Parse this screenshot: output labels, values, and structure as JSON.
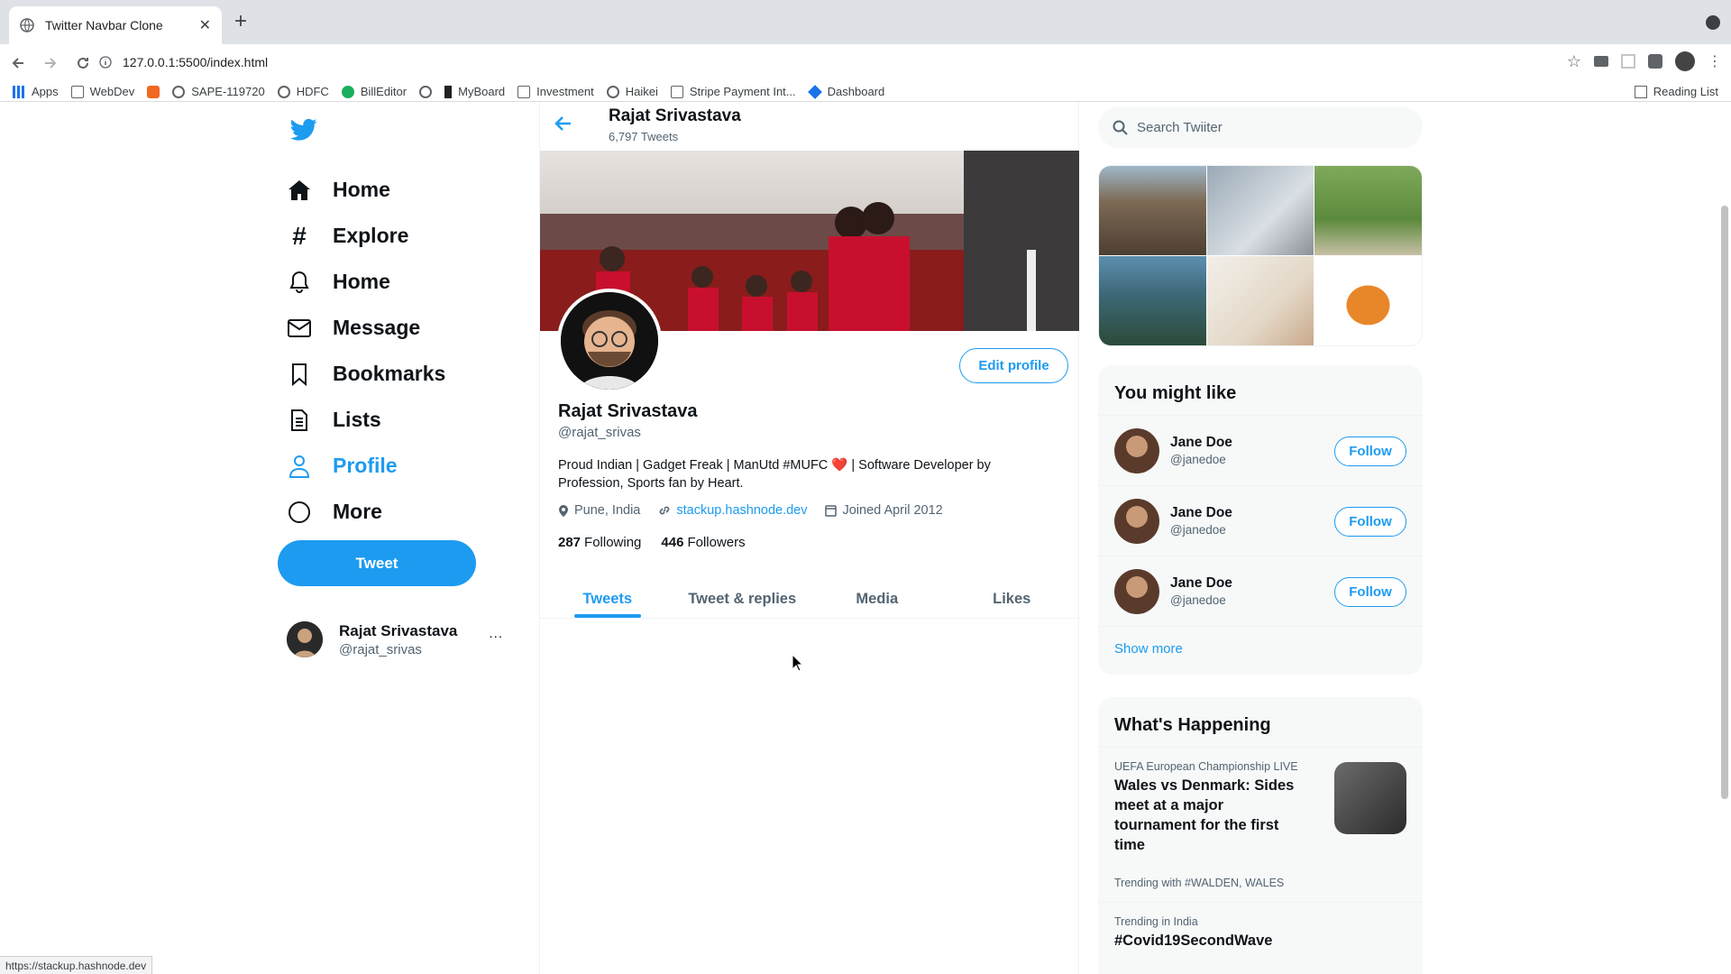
{
  "browser": {
    "tab_title": "Twitter Navbar Clone",
    "url": "127.0.0.1:5500/index.html",
    "status_url": "https://stackup.hashnode.dev",
    "bookmarks": [
      "Apps",
      "WebDev",
      "SAPE-119720",
      "HDFC",
      "BillEditor",
      "MyBoard",
      "Investment",
      "Haikei",
      "Stripe Payment Int...",
      "Dashboard"
    ],
    "reading_list": "Reading List"
  },
  "sidebar": {
    "items": [
      {
        "label": "Home",
        "icon": "home-icon"
      },
      {
        "label": "Explore",
        "icon": "hashtag-icon"
      },
      {
        "label": "Home",
        "icon": "bell-icon"
      },
      {
        "label": "Message",
        "icon": "envelope-icon"
      },
      {
        "label": "Bookmarks",
        "icon": "bookmark-icon"
      },
      {
        "label": "Lists",
        "icon": "list-icon"
      },
      {
        "label": "Profile",
        "icon": "user-icon"
      },
      {
        "label": "More",
        "icon": "circle-icon"
      }
    ],
    "active_item": "Profile",
    "tweet_label": "Tweet",
    "account": {
      "name": "Rajat Srivastava",
      "handle": "@rajat_srivas",
      "more": "..."
    }
  },
  "profile": {
    "header_name": "Rajat Srivastava",
    "tweet_count": "6,797 Tweets",
    "name": "Rajat Srivastava",
    "handle": "@rajat_srivas",
    "bio": "Proud Indian | Gadget Freak | ManUtd #MUFC ❤️ | Software Developer by Profession, Sports fan by Heart.",
    "location": "Pune, India",
    "website": "stackup.hashnode.dev",
    "joined": "Joined April 2012",
    "following_count": "287",
    "following_label": "Following",
    "followers_count": "446",
    "followers_label": "Followers",
    "edit_label": "Edit profile",
    "tabs": [
      "Tweets",
      "Tweet & replies",
      "Media",
      "Likes"
    ],
    "active_tab": "Tweets"
  },
  "right": {
    "search_placeholder": "Search Twiiter",
    "might_like_title": "You might like",
    "suggestions": [
      {
        "name": "Jane Doe",
        "handle": "@janedoe",
        "button": "Follow"
      },
      {
        "name": "Jane Doe",
        "handle": "@janedoe",
        "button": "Follow"
      },
      {
        "name": "Jane Doe",
        "handle": "@janedoe",
        "button": "Follow"
      }
    ],
    "show_more": "Show more",
    "happening_title": "What's Happening",
    "trends": [
      {
        "category": "UEFA European Championship LIVE",
        "title": "Wales vs Denmark: Sides meet at a major tournament for the first time",
        "footer": "Trending with #WALDEN, WALES"
      },
      {
        "category": "Trending in India",
        "title": "#Covid19SecondWave"
      }
    ]
  },
  "colors": {
    "accent": "#1d9bf0",
    "text": "#0f1419",
    "muted": "#536471"
  }
}
